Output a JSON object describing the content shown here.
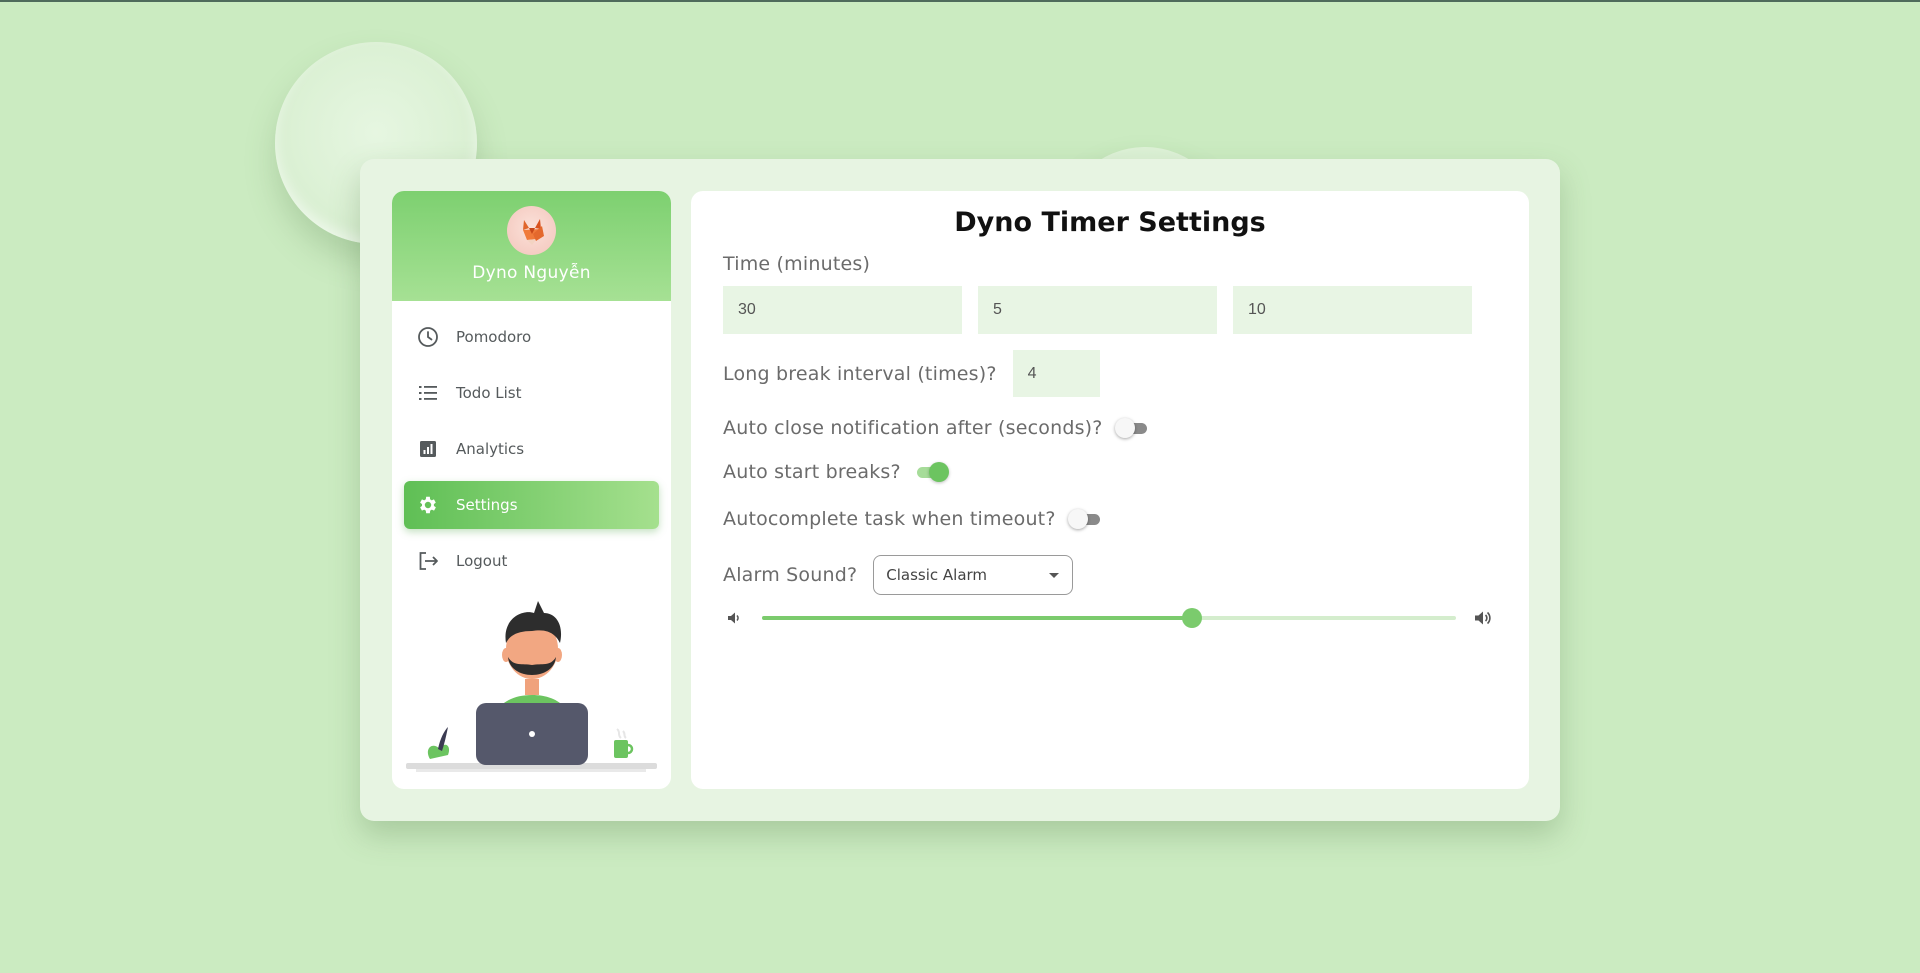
{
  "user": {
    "name": "Dyno Nguyễn"
  },
  "sidebar": {
    "items": [
      {
        "label": "Pomodoro",
        "icon": "clock-icon",
        "active": false
      },
      {
        "label": "Todo List",
        "icon": "list-icon",
        "active": false
      },
      {
        "label": "Analytics",
        "icon": "chart-icon",
        "active": false
      },
      {
        "label": "Settings",
        "icon": "gear-icon",
        "active": true
      },
      {
        "label": "Logout",
        "icon": "logout-icon",
        "active": false
      }
    ]
  },
  "settings": {
    "title": "Dyno Timer Settings",
    "time_label": "Time (minutes)",
    "time_values": [
      "30",
      "5",
      "10"
    ],
    "interval_label": "Long break interval (times)?",
    "interval_value": "4",
    "auto_close_label": "Auto close notification after (seconds)?",
    "auto_close_on": false,
    "auto_start_label": "Auto start breaks?",
    "auto_start_on": true,
    "autocomplete_label": "Autocomplete task when timeout?",
    "autocomplete_on": false,
    "alarm_label": "Alarm Sound?",
    "alarm_selected": "Classic Alarm",
    "volume": 0.62
  },
  "colors": {
    "background": "#cbebc1",
    "accent": "#6cc460",
    "accent_light": "#a6dc99",
    "input_bg": "#e8f5e4"
  }
}
